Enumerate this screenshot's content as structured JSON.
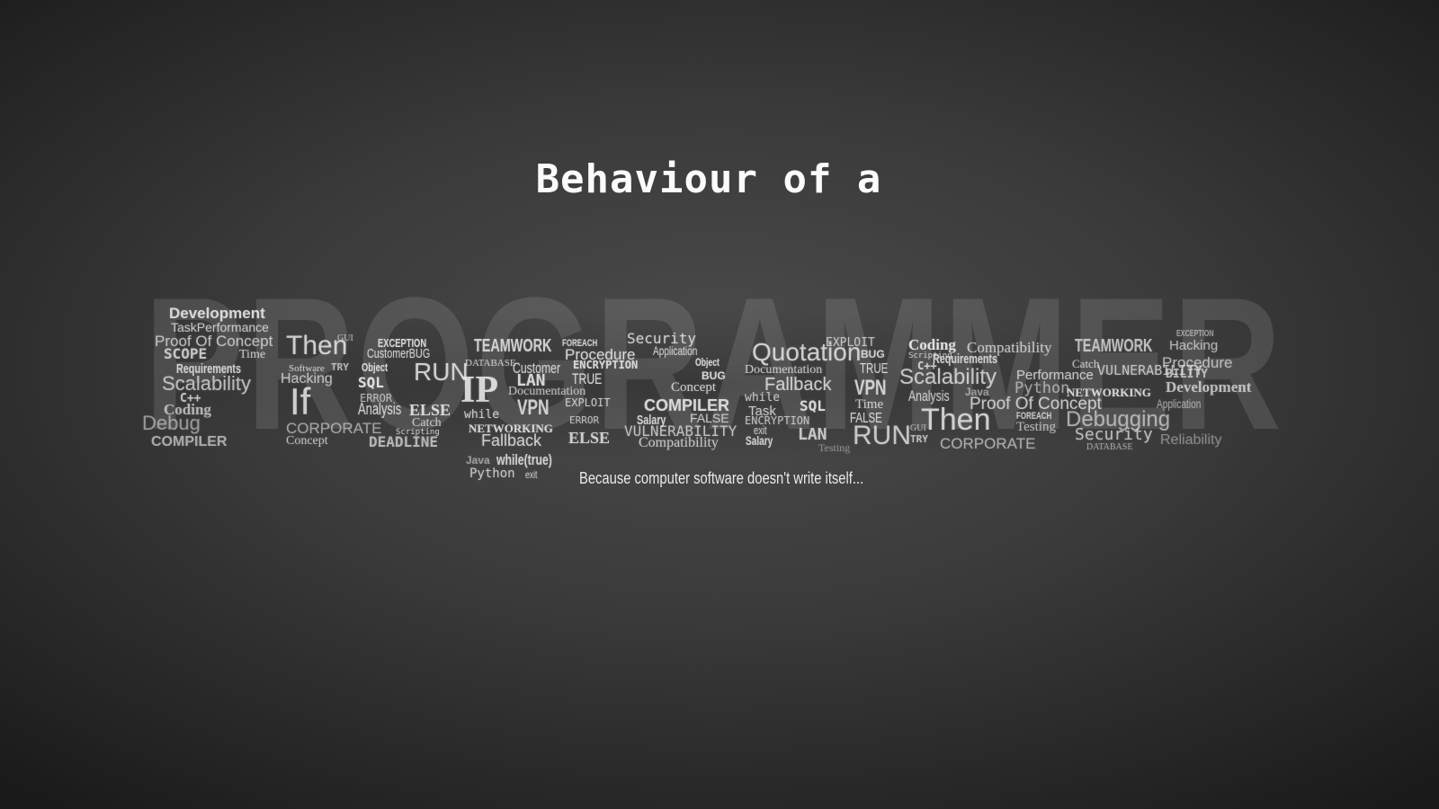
{
  "title": "Behaviour of a",
  "tagline": "Because computer software doesn't write itself...",
  "word_cloud": {
    "hidden_word": "PROGRAMMER",
    "words": [
      "Development",
      "TaskPerformance",
      "Proof Of Concept",
      "SCOPE",
      "Time",
      "Requirements",
      "Scalability",
      "C++",
      "Coding",
      "Debug",
      "COMPILER",
      "Then",
      "GUI",
      "Software",
      "TRY",
      "Hacking",
      "If",
      "CORPORATE",
      "Concept",
      "EXCEPTION",
      "CustomerBUG",
      "Object",
      "SQL",
      "RUN",
      "ERROR",
      "Analysis",
      "ELSE",
      "Catch",
      "Scripting",
      "DEADLINE",
      "TEAMWORK",
      "FOREACH",
      "Security",
      "Application",
      "DATABASE",
      "Customer",
      "Procedure",
      "ENCRYPTION",
      "IP",
      "LAN",
      "TRUE",
      "Documentation",
      "while",
      "VPN",
      "EXPLOIT",
      "NETWORKING",
      "Fallback",
      "ERROR",
      "ELSE",
      "Java",
      "while(true)",
      "Python",
      "exit",
      "Object",
      "BUG",
      "Concept",
      "COMPILER",
      "Salary",
      "FALSE",
      "VULNERABILITY",
      "Compatibility",
      "Quotation",
      "EXPLOIT",
      "BUG",
      "Documentation",
      "TRUE",
      "Fallback",
      "VPN",
      "while",
      "SQL",
      "Time",
      "Task",
      "ENCRYPTION",
      "FALSE",
      "exit",
      "Salary",
      "LAN",
      "RUN",
      "Testing",
      "Coding",
      "Compatibility",
      "Scripting",
      "Requirements",
      "C++",
      "Scalability",
      "Performance",
      "VULNERABILITY",
      "Analysis",
      "Java",
      "Python",
      "NETWORKING",
      "Proof Of Concept",
      "Then",
      "GUI",
      "TRY",
      "FOREACH",
      "Testing",
      "CORPORATE",
      "Debugging",
      "Security",
      "DATABASE",
      "TEAMWORK",
      "EXCEPTION",
      "Hacking",
      "Catch",
      "Procedure",
      "BILITY",
      "Development",
      "Application",
      "Reliability"
    ]
  }
}
